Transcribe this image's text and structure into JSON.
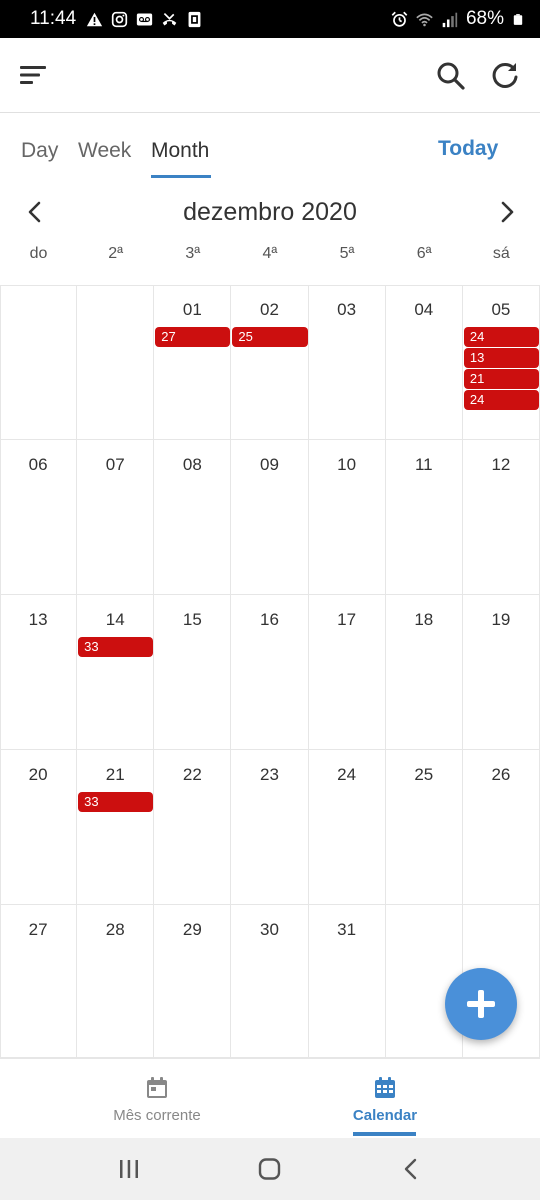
{
  "status_bar": {
    "time": "11:44",
    "battery": "68%",
    "left_icons": [
      "warning-icon",
      "instagram-icon",
      "voicemail-icon",
      "missed-call-icon",
      "screenshot-icon"
    ],
    "right_icons": [
      "alarm-icon",
      "wifi-icon",
      "signal-icon",
      "battery-icon"
    ]
  },
  "app_bar": {
    "menu_icon": "sort-menu-icon",
    "search_icon": "search-icon",
    "refresh_icon": "refresh-icon"
  },
  "view_tabs": {
    "day": "Day",
    "week": "Week",
    "month": "Month",
    "today": "Today",
    "active": "month"
  },
  "month_header": {
    "title": "dezembro 2020"
  },
  "weekdays": [
    "do",
    "2ª",
    "3ª",
    "4ª",
    "5ª",
    "6ª",
    "sá"
  ],
  "weeks": [
    [
      {
        "day": "",
        "events": []
      },
      {
        "day": "",
        "events": []
      },
      {
        "day": "01",
        "events": [
          "27"
        ]
      },
      {
        "day": "02",
        "events": [
          "25"
        ]
      },
      {
        "day": "03",
        "events": []
      },
      {
        "day": "04",
        "events": []
      },
      {
        "day": "05",
        "events": [
          "24",
          "13",
          "21",
          "24"
        ]
      }
    ],
    [
      {
        "day": "06",
        "events": []
      },
      {
        "day": "07",
        "events": []
      },
      {
        "day": "08",
        "events": []
      },
      {
        "day": "09",
        "events": []
      },
      {
        "day": "10",
        "events": []
      },
      {
        "day": "11",
        "events": []
      },
      {
        "day": "12",
        "events": []
      }
    ],
    [
      {
        "day": "13",
        "events": []
      },
      {
        "day": "14",
        "events": [
          "33"
        ]
      },
      {
        "day": "15",
        "events": []
      },
      {
        "day": "16",
        "events": []
      },
      {
        "day": "17",
        "events": []
      },
      {
        "day": "18",
        "events": []
      },
      {
        "day": "19",
        "events": []
      }
    ],
    [
      {
        "day": "20",
        "events": []
      },
      {
        "day": "21",
        "events": [
          "33"
        ]
      },
      {
        "day": "22",
        "events": []
      },
      {
        "day": "23",
        "events": []
      },
      {
        "day": "24",
        "events": []
      },
      {
        "day": "25",
        "events": []
      },
      {
        "day": "26",
        "events": []
      }
    ],
    [
      {
        "day": "27",
        "events": []
      },
      {
        "day": "28",
        "events": []
      },
      {
        "day": "29",
        "events": []
      },
      {
        "day": "30",
        "events": []
      },
      {
        "day": "31",
        "events": []
      },
      {
        "day": "",
        "events": []
      },
      {
        "day": "",
        "events": []
      }
    ]
  ],
  "fab": {
    "icon": "plus-icon"
  },
  "bottom_nav": {
    "items": [
      {
        "label": "Mês corrente",
        "icon": "calendar-day-icon",
        "active": false
      },
      {
        "label": "Calendar",
        "icon": "calendar-grid-icon",
        "active": true
      }
    ]
  },
  "system_nav": [
    "recents-icon",
    "home-icon",
    "back-icon"
  ],
  "colors": {
    "accent": "#3b82c4",
    "event": "#cc0f0f",
    "fab": "#4a90d9"
  }
}
